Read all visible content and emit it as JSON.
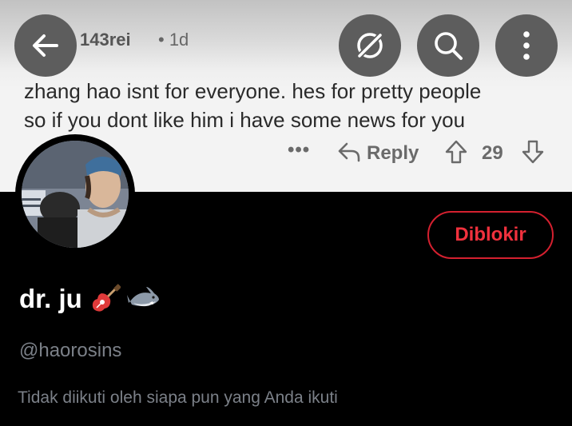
{
  "banner": {
    "post": {
      "username": "143rei",
      "time": "• 1d",
      "comment_lines": [
        "zhang hao isnt for everyone. hes for pretty people",
        "so if you dont like him i have some news for you"
      ],
      "more_label": "•••",
      "reply_label": "Reply",
      "vote_count": "29"
    }
  },
  "toolbar": {
    "back_icon": "arrow-left-icon",
    "grok_icon": "grok-icon",
    "search_icon": "search-icon",
    "more_icon": "more-vertical-icon"
  },
  "profile": {
    "display_name": "dr. ju",
    "emojis": [
      "guitar-icon",
      "shark-icon"
    ],
    "handle": "@haorosins",
    "blocked_button": "Diblokir",
    "follow_note": "Tidak diikuti oleh siapa pun yang Anda ikuti"
  },
  "colors": {
    "background": "#000000",
    "blocked_red": "#f4212e",
    "muted_text": "#71767b",
    "banner_bg": "#f3f3f3"
  }
}
